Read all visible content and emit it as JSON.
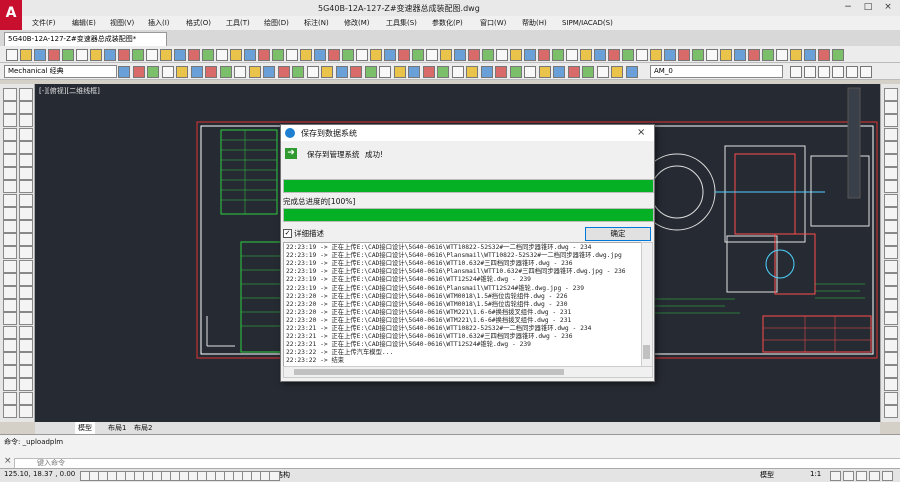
{
  "app": {
    "logo": "A",
    "title": "5G40B-12A-127-Z#变速器总成装配图.dwg",
    "colors": {
      "accent": "#c8102e",
      "progress": "#06b025",
      "canvas_bg": "#262b33"
    }
  },
  "menu": [
    "文件(F)",
    "编辑(E)",
    "视图(V)",
    "插入(I)",
    "格式(O)",
    "工具(T)",
    "绘图(D)",
    "标注(N)",
    "修改(M)",
    "工具集(S)",
    "参数化(P)",
    "窗口(W)",
    "帮助(H)",
    "SIPM/IACAD(S)"
  ],
  "tab": {
    "file_label": "5G40B-12A-127-Z#变速器总成装配图*"
  },
  "toolbar": {
    "workspace": "Mechanical 经典",
    "layer": "AM_0"
  },
  "canvas": {
    "view_label": "[-][俯视][二维线框]"
  },
  "layout_tabs": [
    "模型",
    "布局1",
    "布局2"
  ],
  "command": {
    "history": "命令: _uploadplm",
    "prompt": "键入命令"
  },
  "status": {
    "coords": "125.10, 18.37 , 0.00",
    "mode": "模型",
    "scale": "1:1",
    "units": "结构"
  },
  "dialog": {
    "title": "保存到数据系统",
    "close": "×",
    "status_label": "保存到管理系统",
    "status_value": "成功!",
    "progress1_percent": 100,
    "progress2_label": "完成总进度的[100%]",
    "progress2_percent": 100,
    "detail_label": "详细描述",
    "detail_checked": "✓",
    "ok_label": "确定",
    "log": [
      "22:23:19 -> 正在上传E:\\CAD接口设计\\5G40-0616\\WTT10822-52S32#一二档同步器锥环.dwg - 234",
      "22:23:19 -> 正在上传E:\\CAD接口设计\\5G40-0616\\Plansmail\\WTT10822-52S32#一二档同步器锥环.dwg.jpg",
      "22:23:19 -> 正在上传E:\\CAD接口设计\\5G40-0616\\WTT10.632#三四档同步器锥环.dwg - 236",
      "22:23:19 -> 正在上传E:\\CAD接口设计\\5G40-0616\\Plansmail\\WTT10.632#三四档同步器锥环.dwg.jpg - 236",
      "22:23:19 -> 正在上传E:\\CAD接口设计\\5G40-0616\\WTT12S24#锥轮.dwg - 239",
      "22:23:19 -> 正在上传E:\\CAD接口设计\\5G40-0616\\Plansmail\\WTT12S24#锥轮.dwg.jpg - 239",
      "22:23:20 -> 正在上传E:\\CAD接口设计\\5G40-0616\\WTM0018\\1.5#挡位齿轮组件.dwg - 226",
      "22:23:20 -> 正在上传E:\\CAD接口设计\\5G40-0616\\WTM0018\\1.5#挡位齿轮组件.dwg - 230",
      "22:23:20 -> 正在上传E:\\CAD接口设计\\5G40-0616\\WTM221\\1.6-6#换挡拨叉组件.dwg - 231",
      "22:23:20 -> 正在上传E:\\CAD接口设计\\5G40-0616\\WTM221\\1.6-6#换挡拨叉组件.dwg - 231",
      "22:23:21 -> 正在上传E:\\CAD接口设计\\5G40-0616\\WTT10822-52S32#一二档同步器锥环.dwg - 234",
      "22:23:21 -> 正在上传E:\\CAD接口设计\\5G40-0616\\WTT10.632#三四档同步器锥环.dwg - 236",
      "22:23:21 -> 正在上传E:\\CAD接口设计\\5G40-0616\\WTT12S24#锥轮.dwg - 239",
      "22:23:22 -> 正在上传汽车模型...",
      "22:23:22 -> 结束"
    ]
  }
}
